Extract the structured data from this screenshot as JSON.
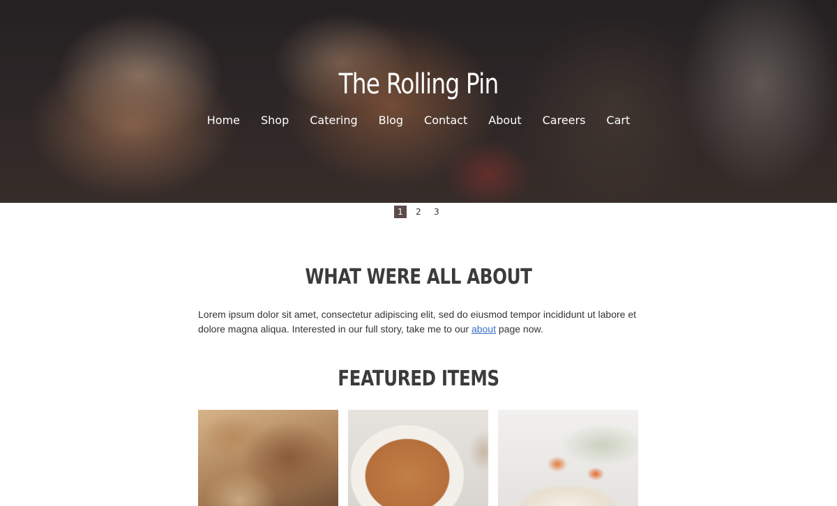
{
  "header": {
    "site_title": "The Rolling Pin",
    "nav": [
      "Home",
      "Shop",
      "Catering",
      "Blog",
      "Contact",
      "About",
      "Careers",
      "Cart"
    ]
  },
  "slider": {
    "pages": [
      "1",
      "2",
      "3"
    ],
    "active_page": "1"
  },
  "about_section": {
    "heading": "WHAT WERE ALL ABOUT",
    "text_before_link": "Lorem ipsum dolor sit amet, consectetur adipiscing elit, sed do eiusmod tempor incididunt ut labore et dolore magna aliqua. Interested in our full story, take me to our ",
    "link_text": "about",
    "text_after_link": " page now."
  },
  "featured": {
    "heading": "FEATURED ITEMS",
    "items": [
      "bread-image",
      "pie-image",
      "tart-image"
    ]
  },
  "colors": {
    "pager_active_bg": "#5b4c4c",
    "link": "#3b6ec5",
    "heading": "#3b3b3b"
  }
}
